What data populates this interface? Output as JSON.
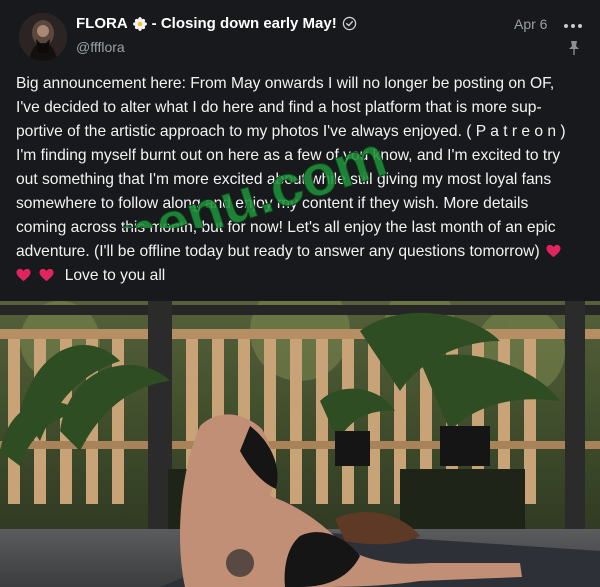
{
  "post": {
    "author": {
      "display_name": "FLORA",
      "name_suffix": "- Closing down early May!",
      "handle": "@ffflora",
      "emoji_icon": "flower-icon",
      "verified_icon": "verified-check-icon"
    },
    "date": "Apr 6",
    "more_icon": "more-dots-icon",
    "pinned_icon": "pin-icon",
    "body_lines": [
      "Big announcement here: From May onwards I will no longer be posting on OF,",
      "I've decided to alter what I do here and find a host platform that is more sup-",
      "portive of the artistic approach to my photos I've always enjoyed. ( P a t r e o n )",
      "I'm finding myself burnt out on here as a few of you know, and I'm excited to try",
      "out something that I'm more excited about while still giving my most loyal fans",
      "somewhere to follow along and enjoy my content if they wish. More details",
      "coming across this month, but for now! Let's all enjoy the last month of an epic",
      "adventure. (I'll be offline today but ready to answer any questions tomorrow)",
      "Love to you all"
    ],
    "heart_icon": "red-heart-icon",
    "accent_colors": {
      "heart": "#e0245e",
      "watermark": "#1f8f3a",
      "text": "#f3f3f3",
      "muted": "#9aa0a6",
      "background": "#17191c"
    }
  },
  "watermark": {
    "text": "fapmenu.com"
  },
  "media": {
    "alt_kind": "photo"
  }
}
